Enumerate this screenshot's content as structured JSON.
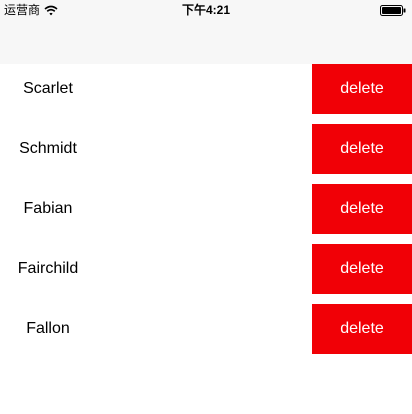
{
  "status_bar": {
    "carrier": "运营商",
    "time": "下午4:21",
    "wifi_icon": "wifi-icon",
    "battery_icon": "battery-icon"
  },
  "nav_bar": {
    "title": ""
  },
  "list": {
    "delete_color": "#f10006",
    "items": [
      {
        "name": "Scarlet",
        "action": "delete"
      },
      {
        "name": "Schmidt",
        "action": "delete"
      },
      {
        "name": "Fabian",
        "action": "delete"
      },
      {
        "name": "Fairchild",
        "action": "delete"
      },
      {
        "name": "Fallon",
        "action": "delete"
      }
    ]
  }
}
